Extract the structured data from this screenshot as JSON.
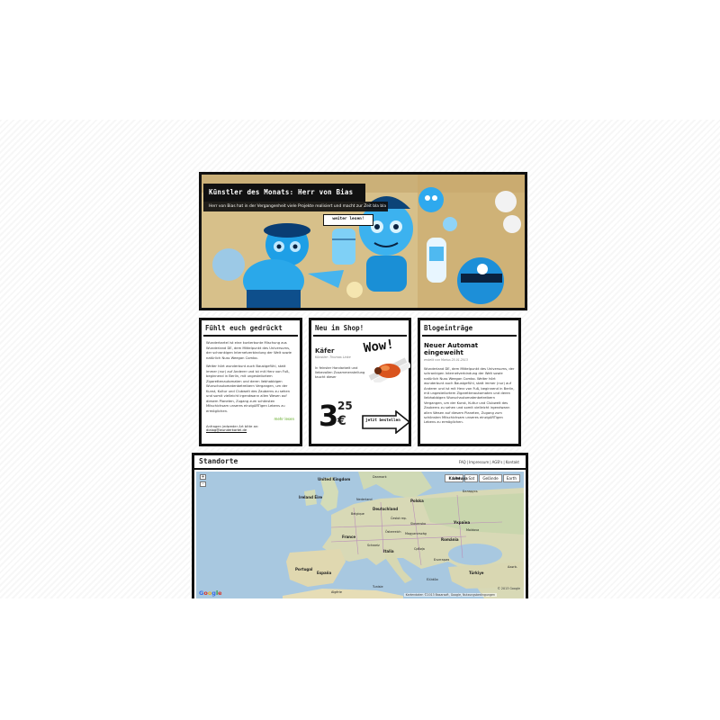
{
  "hero": {
    "title": "Künstler des Monats: Herr von Bias",
    "subtitle": "Herr von Bias hat in der Vergangenheit viele Projekte realisiert und macht zur Zeit bla bla",
    "more_label": "weiter lesen!"
  },
  "box1": {
    "heading": "Fühlt euch gedrückt",
    "paragraph1": "Wunderkartel ist eine kunterbunte Mischung aus Wunderland DE, dem Mittelpunkt des Universums, der schrankigen Internetverbindung der Welt sowie natürlich Nuss Weegan Combo.",
    "paragraph2": "Weiter hört wunderbunt auch Baustgefühl, statt immer (nur) auf Anderer und ist mit Herz von Fuß, beginnend in Berlin, mit ungesteilortem Zigarettenautomaten und deren liebhabbigen Wunschautomatenbetreibern Vergangen, um der Kunst, Kultur und Clubwelt des Zauberns zu sehen und somit vielleicht irgendwann allen Wesen auf diesem Planeten, Zugang zum schönsten Mitschichsam unseres einzigARTigen Lebens zu ermöglichen.",
    "more_label": "mehr lesen",
    "contact_prefix": "Anfragen jedweder Art bitte an:",
    "contact_email": "dialog@wunderkartel.de"
  },
  "box2": {
    "heading": "Neu im Shop!",
    "product_name": "Käfer",
    "product_meta": "Künstler: Thomas Linke",
    "product_desc": "In feinster Handarbeit und liebevollen Zusammenstellung taucht dieser",
    "wow": "Wow!",
    "price_int": "3",
    "price_dec": "25",
    "price_cur": "€",
    "buy_label": "jetzt bestellen"
  },
  "box3": {
    "heading": "Blogeinträge",
    "post_title": "Neuer Automat eingeweiht",
    "post_meta": "erstellt von Marius 25.01.2013",
    "post_text": "Wunderland DE, dem Mittelpunkt des Universums, der schrankigen Internetverbindung der Welt sowie natürlich Nuss Weegan Combo. Weiter hört wunderbunt auch Baustgefühl, statt immer (nur) auf Anderer und ist mit Herz von Fuß, beginnend in Berlin, mit ungesteilortem Zigarettenautomaten und deren liebhabbigen Wunschautomatenbetreibern Vergangen, um der Kunst, Kultur und Clubwelt des Zauberns zu sehen und somit vielleicht irgendwann allen Wesen auf diesem Planeten, Zugang zum schönsten Mitschichsam unseres einzigARTigen Lebens zu ermöglichen."
  },
  "locations": {
    "heading": "Standorte",
    "links": [
      "FAQ",
      "Impressum",
      "AGB's",
      "Kontakt"
    ],
    "map_types": [
      "Karte",
      "Sat",
      "Gelände",
      "Earth"
    ],
    "zoom_in": "+",
    "zoom_out": "-",
    "labels": {
      "uk": "United Kingdom",
      "ireland": "Ireland Éire",
      "denmark": "Danmark",
      "lietuva": "Lietuva",
      "belarus": "Беларусь",
      "polska": "Polska",
      "nederland": "Nederland",
      "deutschland": "Deutschland",
      "belgique": "Belgique",
      "ceska": "Česká rep.",
      "ukraina": "Україна",
      "moldova": "Moldova",
      "slovensko": "Slovensko",
      "osterreich": "Österreich",
      "magyar": "Magyarország",
      "romania": "România",
      "france": "France",
      "schweiz": "Schweiz",
      "italia": "Italia",
      "srbija": "Србија",
      "bulgaria": "България",
      "portugal": "Portugal",
      "espana": "España",
      "ellada": "Ελλάδα",
      "turkiye": "Türkiye",
      "azerbaycan": "Azərb.",
      "algerie": "Algérie",
      "tunisie": "Tunisie"
    },
    "copyright": "© 2013 Google",
    "mapdata": "Kartendaten ©2013 Basarsoft, Google, Nutzungsbedingungen",
    "google_letters": [
      "G",
      "o",
      "o",
      "g",
      "l",
      "e"
    ]
  },
  "colors": {
    "accent_green": "#5aa61d",
    "hero_blue": "#1e9fe6",
    "ink": "#111111"
  }
}
